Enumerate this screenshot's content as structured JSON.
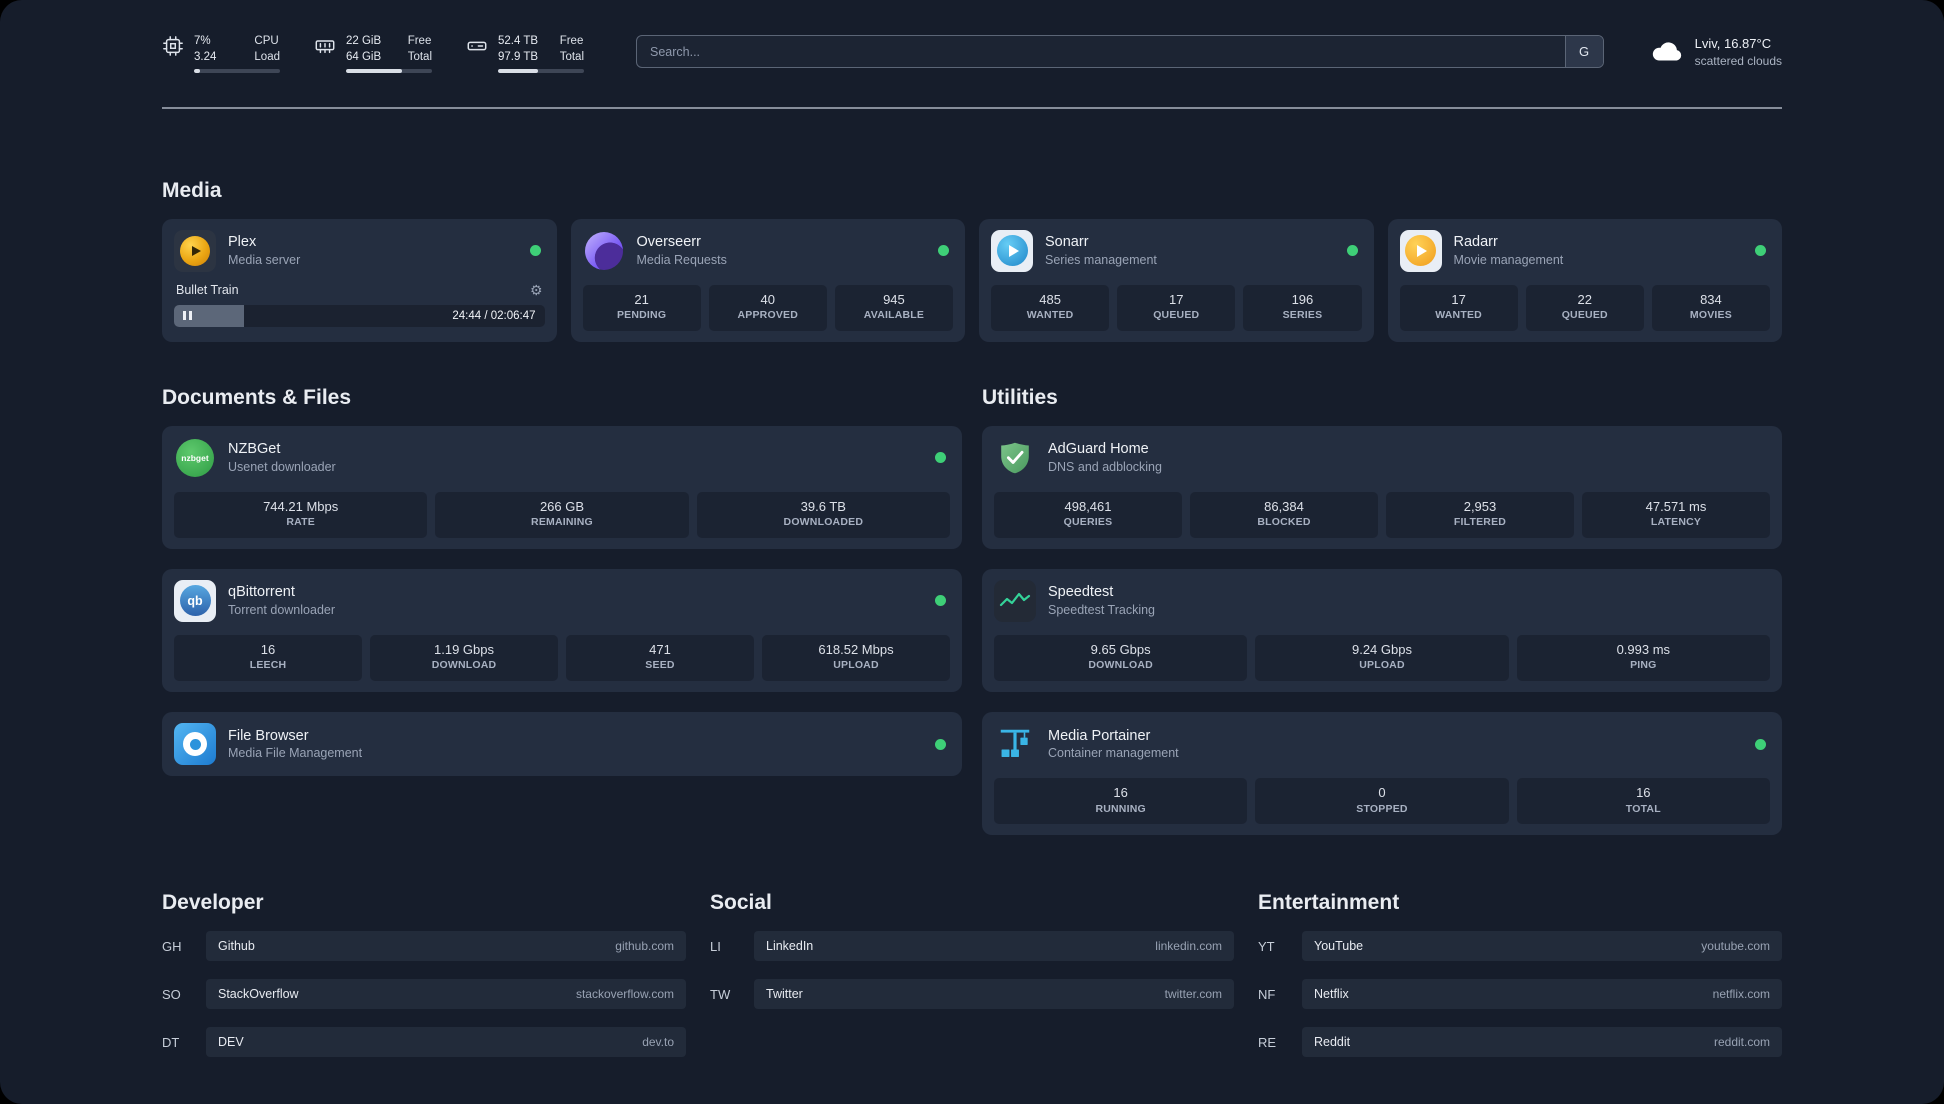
{
  "colors": {
    "page_background": "#161d2b",
    "card_background": "#242e40",
    "stat_background": "#1b2332",
    "status_online": "#3ecf77",
    "plex": "#eba613",
    "overseerr": "#7b5cf5",
    "sonarr": "#2193d1",
    "radarr": "#f0a928",
    "nzbget": "#3aa74e",
    "qbittorrent": "#3a79c4",
    "adguard": "#67b279",
    "speedtest": "#34d399",
    "portainer": "#3ab5e6",
    "filebrowser": "#2a93dc"
  },
  "topbar": {
    "resources": [
      {
        "icon": "cpu-icon",
        "values": [
          "7%",
          "3.24"
        ],
        "labels": [
          "CPU",
          "Load"
        ],
        "progress": 7
      },
      {
        "icon": "memory-icon",
        "values": [
          "22 GiB",
          "64 GiB"
        ],
        "labels": [
          "Free",
          "Total"
        ],
        "progress": 65
      },
      {
        "icon": "disk-icon",
        "values": [
          "52.4 TB",
          "97.9 TB"
        ],
        "labels": [
          "Free",
          "Total"
        ],
        "progress": 46
      }
    ],
    "search": {
      "placeholder": "Search...",
      "button_label": "G"
    },
    "weather": {
      "location": "Lviv, 16.87°C",
      "condition": "scattered clouds"
    }
  },
  "media": {
    "title": "Media",
    "cards": [
      {
        "name": "Plex",
        "subtitle": "Media server",
        "status": "online",
        "now_playing": "Bullet Train",
        "time": "24:44 / 02:06:47",
        "progress": 19
      },
      {
        "name": "Overseerr",
        "subtitle": "Media Requests",
        "status": "online",
        "stats": [
          {
            "value": "21",
            "label": "PENDING"
          },
          {
            "value": "40",
            "label": "APPROVED"
          },
          {
            "value": "945",
            "label": "AVAILABLE"
          }
        ]
      },
      {
        "name": "Sonarr",
        "subtitle": "Series management",
        "status": "online",
        "stats": [
          {
            "value": "485",
            "label": "WANTED"
          },
          {
            "value": "17",
            "label": "QUEUED"
          },
          {
            "value": "196",
            "label": "SERIES"
          }
        ]
      },
      {
        "name": "Radarr",
        "subtitle": "Movie management",
        "status": "online",
        "stats": [
          {
            "value": "17",
            "label": "WANTED"
          },
          {
            "value": "22",
            "label": "QUEUED"
          },
          {
            "value": "834",
            "label": "MOVIES"
          }
        ]
      }
    ]
  },
  "documents": {
    "title": "Documents & Files",
    "cards": [
      {
        "name": "NZBGet",
        "subtitle": "Usenet downloader",
        "status": "online",
        "icon_text": "nzbget",
        "stats": [
          {
            "value": "744.21 Mbps",
            "label": "RATE"
          },
          {
            "value": "266 GB",
            "label": "REMAINING"
          },
          {
            "value": "39.6 TB",
            "label": "DOWNLOADED"
          }
        ]
      },
      {
        "name": "qBittorrent",
        "subtitle": "Torrent downloader",
        "status": "online",
        "icon_text": "qb",
        "stats": [
          {
            "value": "16",
            "label": "LEECH"
          },
          {
            "value": "1.19 Gbps",
            "label": "DOWNLOAD"
          },
          {
            "value": "471",
            "label": "SEED"
          },
          {
            "value": "618.52 Mbps",
            "label": "UPLOAD"
          }
        ]
      },
      {
        "name": "File Browser",
        "subtitle": "Media File Management",
        "status": "online"
      }
    ]
  },
  "utilities": {
    "title": "Utilities",
    "cards": [
      {
        "name": "AdGuard Home",
        "subtitle": "DNS and adblocking",
        "stats": [
          {
            "value": "498,461",
            "label": "QUERIES"
          },
          {
            "value": "86,384",
            "label": "BLOCKED"
          },
          {
            "value": "2,953",
            "label": "FILTERED"
          },
          {
            "value": "47.571 ms",
            "label": "LATENCY"
          }
        ]
      },
      {
        "name": "Speedtest",
        "subtitle": "Speedtest Tracking",
        "stats": [
          {
            "value": "9.65 Gbps",
            "label": "DOWNLOAD"
          },
          {
            "value": "9.24 Gbps",
            "label": "UPLOAD"
          },
          {
            "value": "0.993 ms",
            "label": "PING"
          }
        ]
      },
      {
        "name": "Media Portainer",
        "subtitle": "Container management",
        "status": "online",
        "stats": [
          {
            "value": "16",
            "label": "RUNNING"
          },
          {
            "value": "0",
            "label": "STOPPED"
          },
          {
            "value": "16",
            "label": "TOTAL"
          }
        ]
      }
    ]
  },
  "bookmarks": [
    {
      "title": "Developer",
      "items": [
        {
          "abbr": "GH",
          "name": "Github",
          "url": "github.com"
        },
        {
          "abbr": "SO",
          "name": "StackOverflow",
          "url": "stackoverflow.com"
        },
        {
          "abbr": "DT",
          "name": "DEV",
          "url": "dev.to"
        }
      ]
    },
    {
      "title": "Social",
      "items": [
        {
          "abbr": "LI",
          "name": "LinkedIn",
          "url": "linkedin.com"
        },
        {
          "abbr": "TW",
          "name": "Twitter",
          "url": "twitter.com"
        }
      ]
    },
    {
      "title": "Entertainment",
      "items": [
        {
          "abbr": "YT",
          "name": "YouTube",
          "url": "youtube.com"
        },
        {
          "abbr": "NF",
          "name": "Netflix",
          "url": "netflix.com"
        },
        {
          "abbr": "RE",
          "name": "Reddit",
          "url": "reddit.com"
        }
      ]
    }
  ]
}
